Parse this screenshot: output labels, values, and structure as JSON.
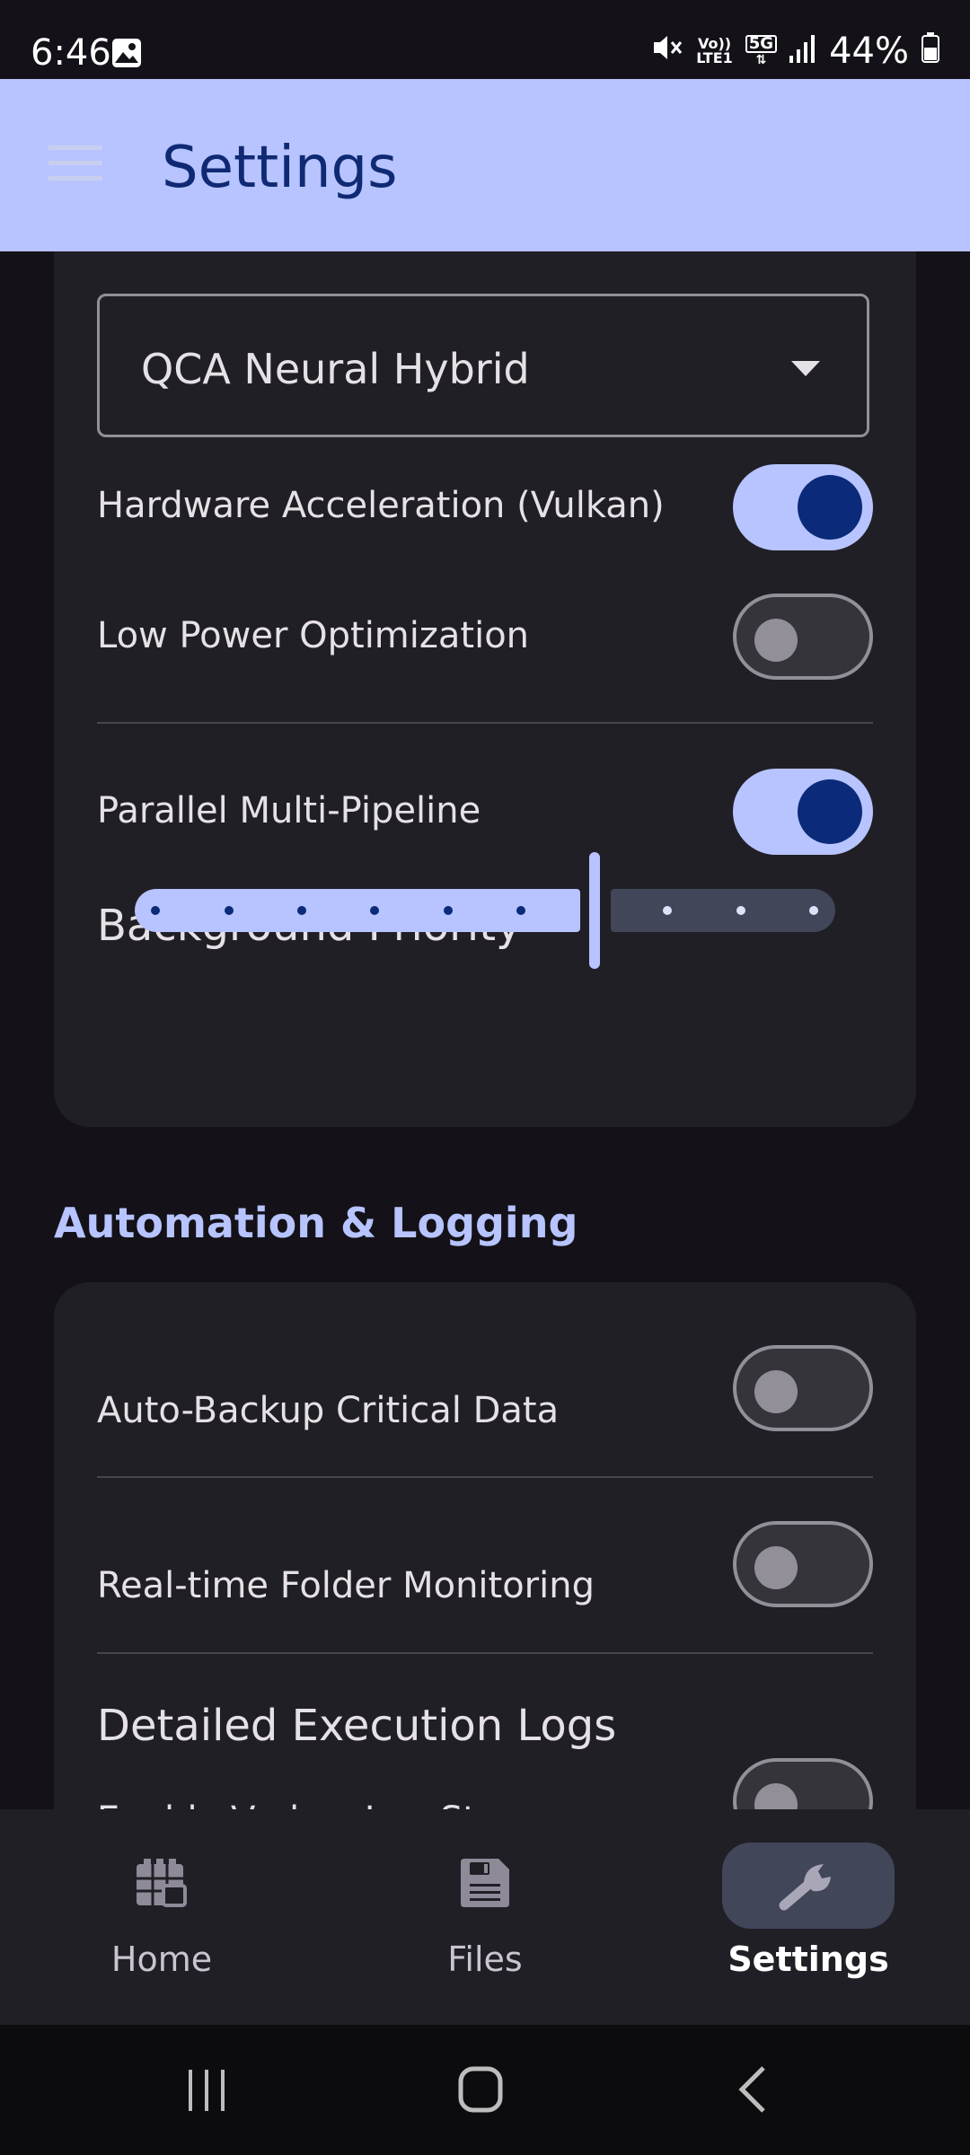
{
  "status_bar": {
    "time": "6:46",
    "volte": "Vo))",
    "lte": "LTE1",
    "network": "5G",
    "battery": "44%"
  },
  "app_bar": {
    "title": "Settings"
  },
  "inference": {
    "engine_selected": "QCA Neural Hybrid",
    "hardware_accel_label": "Hardware Acceleration (Vulkan)",
    "hardware_accel_on": true,
    "low_power_label": "Low Power Optimization",
    "low_power_on": false,
    "parallel_label": "Parallel Multi-Pipeline",
    "parallel_on": true,
    "priority_label": "Background Priority",
    "priority_value_fraction": 0.6
  },
  "automation": {
    "heading": "Automation & Logging",
    "auto_backup_label": "Auto-Backup Critical Data",
    "auto_backup_on": false,
    "folder_monitor_label": "Real-time Folder Monitoring",
    "folder_monitor_on": false,
    "logs_heading": "Detailed Execution Logs",
    "verbose_label": "Enable Verbos Log Streams",
    "verbose_on": false
  },
  "bottom_nav": {
    "home": "Home",
    "files": "Files",
    "settings": "Settings",
    "active": "settings"
  },
  "colors": {
    "accent": "#b7c4ff",
    "accent_dark": "#0b2a7a",
    "surface": "#211f26",
    "background": "#141218"
  },
  "icons": {
    "menu": "hamburger-menu-icon",
    "home": "grid-home-icon",
    "files": "save-disk-icon",
    "settings": "wrench-icon"
  }
}
